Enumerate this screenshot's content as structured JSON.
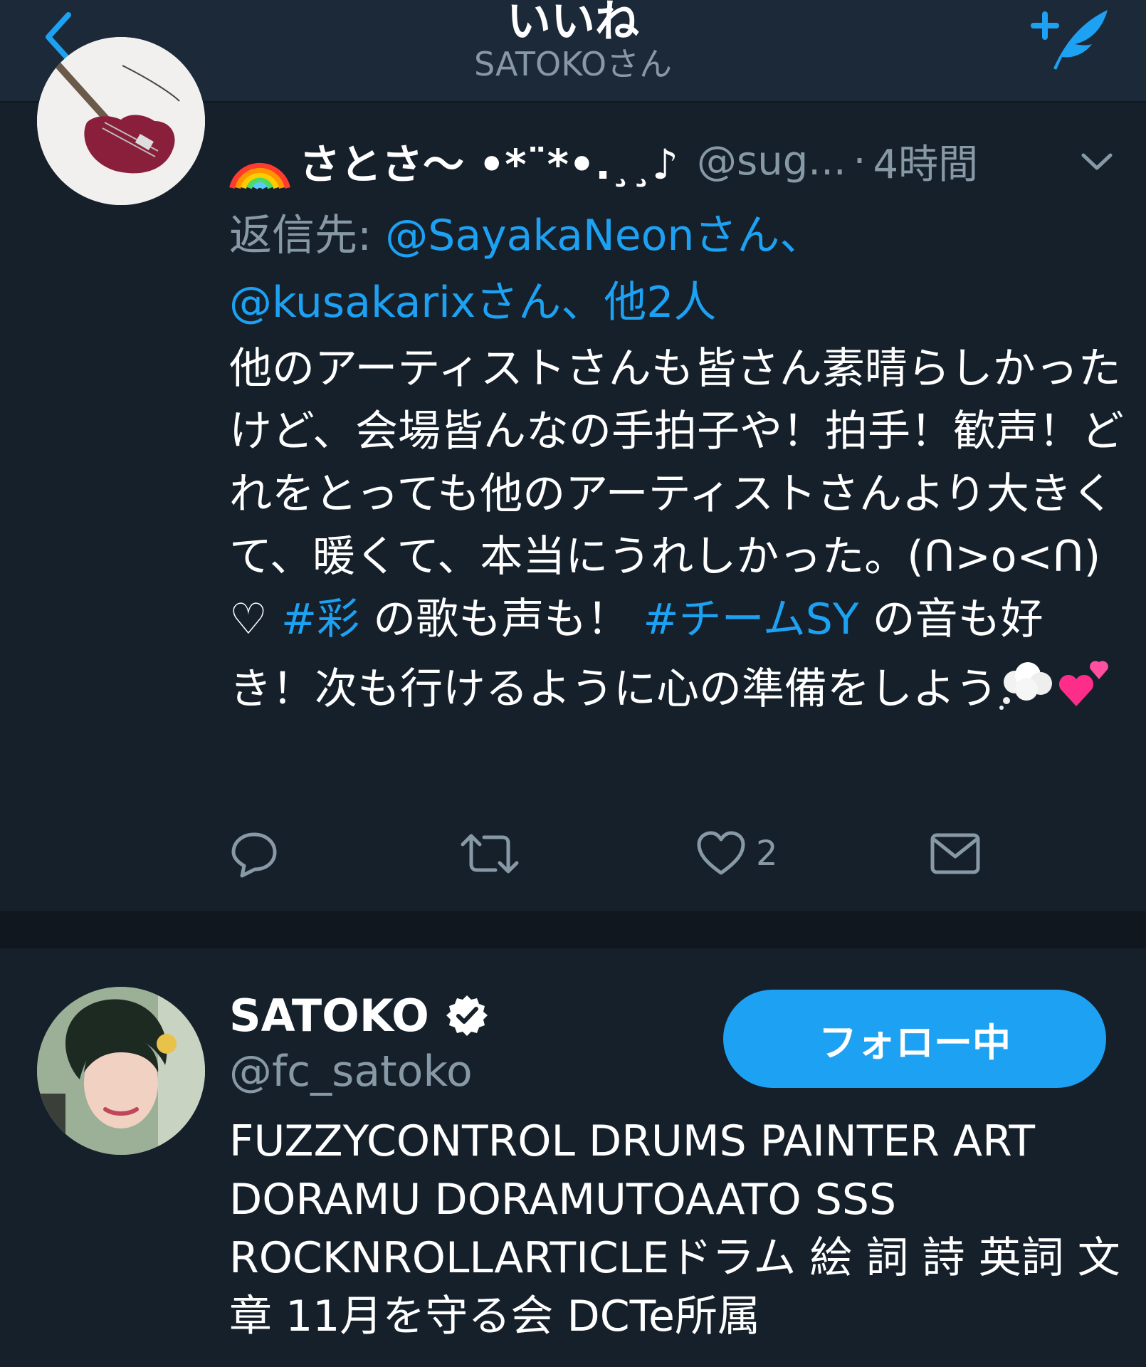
{
  "header": {
    "title": "いいね",
    "subtitle": "SATOKOさん"
  },
  "tweet": {
    "display_name": "さとさ〜 •*¨*•.¸¸♪",
    "handle": "@sug...",
    "separator": "·",
    "time": "4時間",
    "reply_prefix": "返信先: ",
    "reply_link1": "@SayakaNeonさん、",
    "reply_link2": "@kusakarixさん、他2人",
    "body_1": "他のアーティストさんも皆さん素晴らしかったけど、会場皆んなの手拍子や！拍手！歓声！どれをとっても他のアーティストさんより大きくて、暖くて、本当にうれしかった。(ᑎ>o<ᑎ)♡ ",
    "hashtag_1": "#彩",
    "body_2": " の歌も声も！ ",
    "hashtag_2": "#チームSY",
    "body_3": " の音も好き！次も行けるように心の準備をしよう",
    "like_count": "2"
  },
  "user": {
    "name": "SATOKO",
    "handle": "@fc_satoko",
    "follow_label": "フォロー中",
    "bio": "FUZZYCONTROL DRUMS PAINTER ART DORAMU DORAMUTOAATO SSS ROCKNROLLARTICLEドラム 絵 詞 詩 英詞 文章 11月を守る会 DCTe所属"
  },
  "colors": {
    "background": "#15202b",
    "header": "#1c2938",
    "accent": "#1da1f2",
    "secondary_text": "#8899a6"
  },
  "icons": {
    "back": "chevron-left-icon",
    "compose": "compose-tweet-icon",
    "caret": "chevron-down-icon",
    "reply": "reply-icon",
    "retweet": "retweet-icon",
    "like": "heart-icon",
    "dm": "direct-message-icon",
    "verified": "verified-badge-icon"
  }
}
